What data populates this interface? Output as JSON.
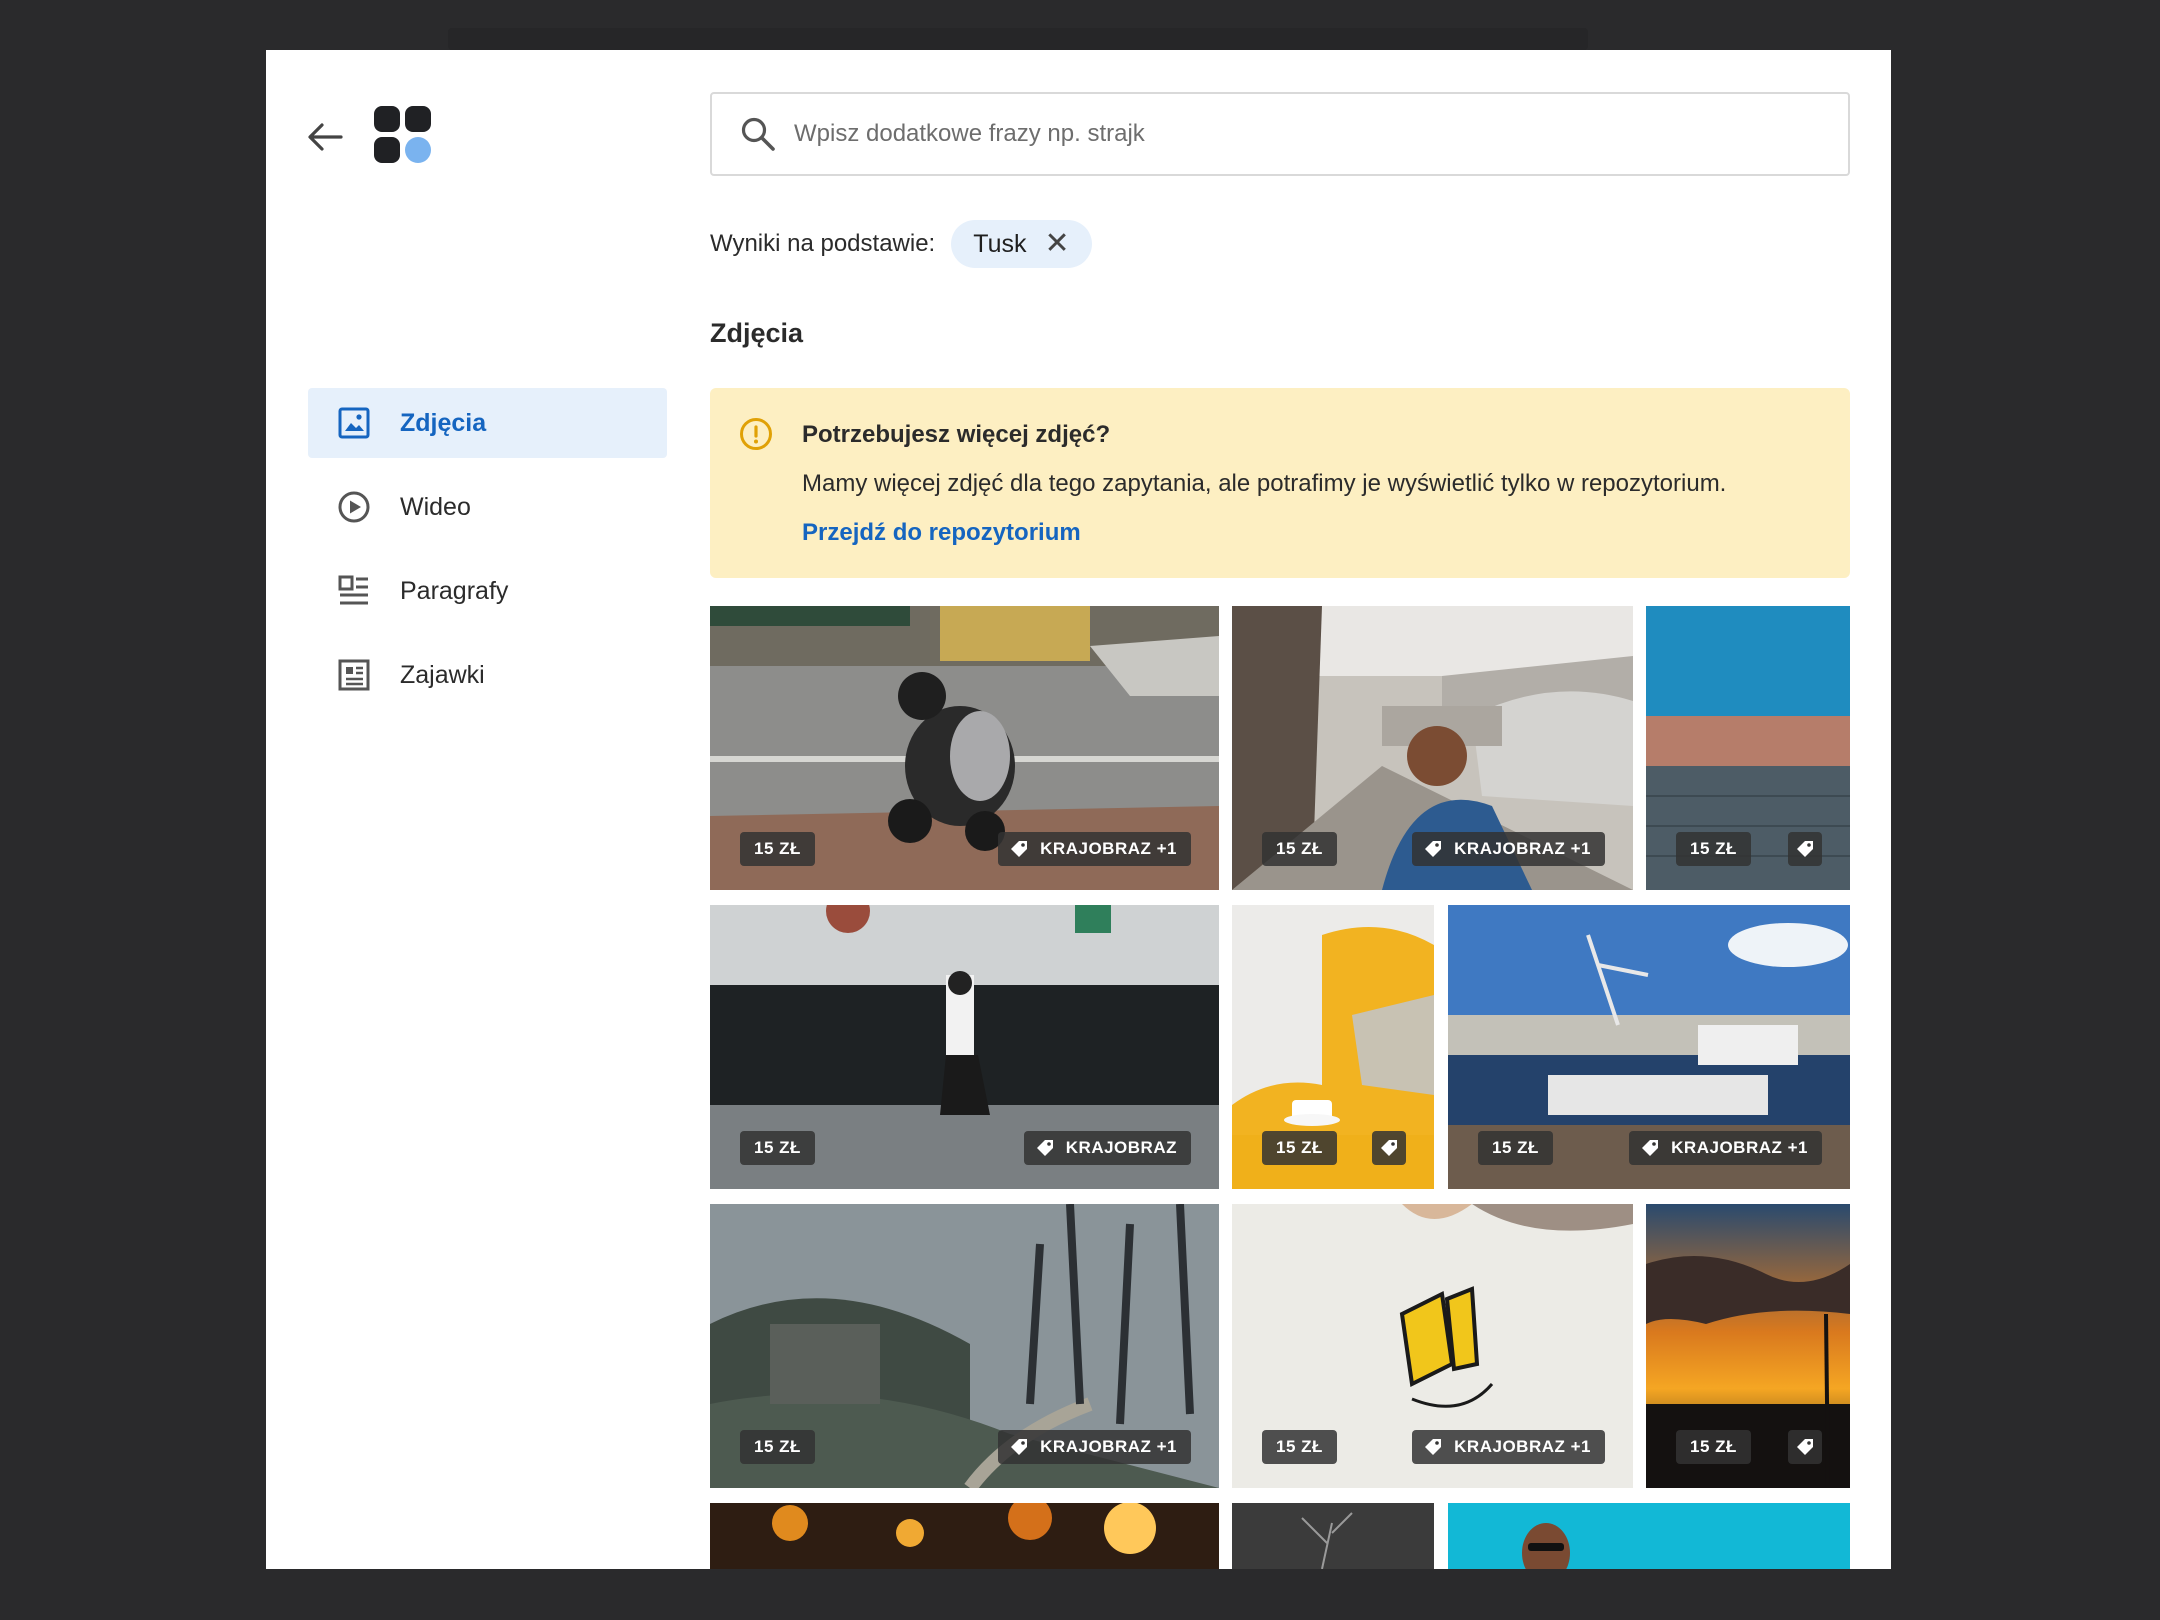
{
  "search": {
    "placeholder": "Wpisz dodatkowe frazy np. strajk"
  },
  "results": {
    "label": "Wyniki na podstawie:",
    "chip": "Tusk",
    "chip_remove": "✕"
  },
  "section_title": "Zdjęcia",
  "sidebar": {
    "items": [
      {
        "label": "Zdjęcia",
        "icon": "image-icon",
        "active": true
      },
      {
        "label": "Wideo",
        "icon": "play-circle-icon",
        "active": false
      },
      {
        "label": "Paragrafy",
        "icon": "paragraphs-icon",
        "active": false
      },
      {
        "label": "Zajawki",
        "icon": "teaser-icon",
        "active": false
      }
    ]
  },
  "banner": {
    "title": "Potrzebujesz więcej zdjęć?",
    "text": "Mamy więcej zdjęć dla tego zapytania, ale potrafimy je wyświetlić tylko w repozytorium.",
    "link": "Przejdź do repozytorium"
  },
  "photos": [
    {
      "price": "15 ZŁ",
      "tag": "KRAJOBRAZ +1"
    },
    {
      "price": "15 ZŁ",
      "tag": "KRAJOBRAZ +1"
    },
    {
      "price": "15 ZŁ",
      "tag": ""
    },
    {
      "price": "15 ZŁ",
      "tag": "KRAJOBRAZ"
    },
    {
      "price": "15 ZŁ",
      "tag": ""
    },
    {
      "price": "15 ZŁ",
      "tag": "KRAJOBRAZ +1"
    },
    {
      "price": "15 ZŁ",
      "tag": "KRAJOBRAZ +1"
    },
    {
      "price": "15 ZŁ",
      "tag": "KRAJOBRAZ +1"
    },
    {
      "price": "15 ZŁ",
      "tag": ""
    }
  ],
  "colors": {
    "accent": "#1565c0",
    "active_bg": "#e6f0fb",
    "banner_bg": "#fdefc2",
    "warning_icon": "#e0a106"
  }
}
